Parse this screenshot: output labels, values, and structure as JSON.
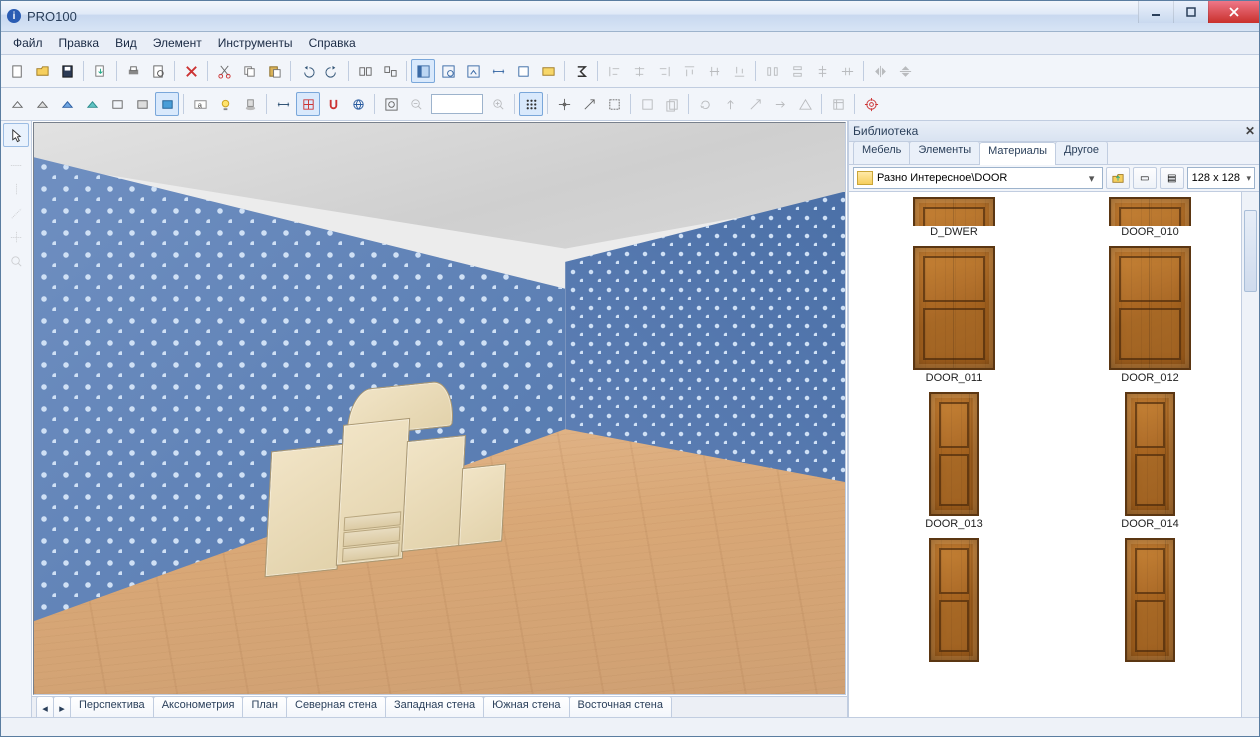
{
  "window": {
    "title": "PRO100"
  },
  "menu": [
    "Файл",
    "Правка",
    "Вид",
    "Элемент",
    "Инструменты",
    "Справка"
  ],
  "view_tabs": [
    "Перспектива",
    "Аксонометрия",
    "План",
    "Северная стена",
    "Западная стена",
    "Южная стена",
    "Восточная стена"
  ],
  "library": {
    "title": "Библиотека",
    "tabs": [
      "Мебель",
      "Элементы",
      "Материалы",
      "Другое"
    ],
    "active_tab": "Материалы",
    "path": "Разно Интересное\\DOOR",
    "thumb_size": "128 x 128",
    "items": [
      {
        "label": "D_DWER",
        "partial": true
      },
      {
        "label": "DOOR_010",
        "partial": true
      },
      {
        "label": "DOOR_011"
      },
      {
        "label": "DOOR_012"
      },
      {
        "label": "DOOR_013",
        "narrow": true
      },
      {
        "label": "DOOR_014",
        "narrow": true
      },
      {
        "label": "",
        "narrow": true
      },
      {
        "label": "",
        "narrow": true
      }
    ]
  }
}
